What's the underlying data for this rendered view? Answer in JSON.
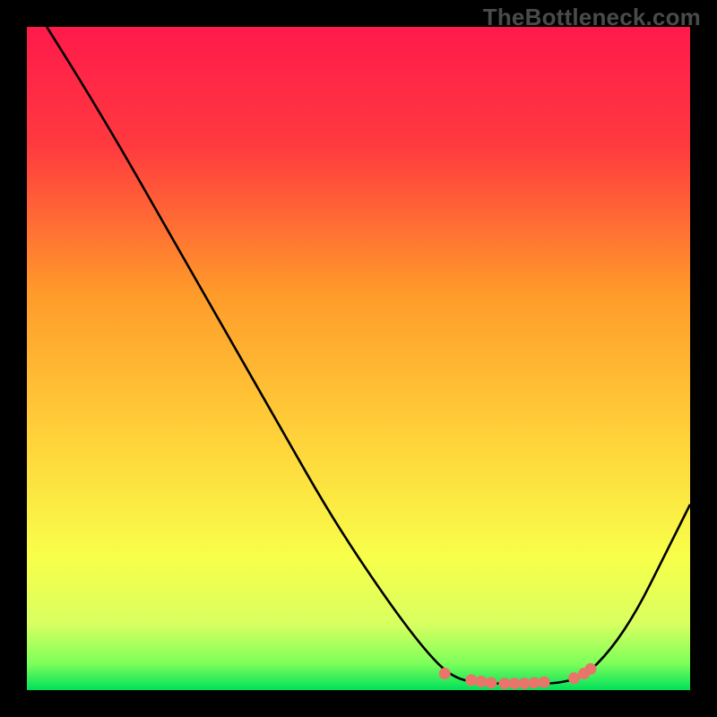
{
  "watermark": "TheBottleneck.com",
  "chart_data": {
    "type": "line",
    "title": "",
    "xlabel": "",
    "ylabel": "",
    "xlim": [
      0,
      100
    ],
    "ylim": [
      0,
      100
    ],
    "gradient_stops": [
      {
        "offset": 0,
        "color": "#ff1a4b"
      },
      {
        "offset": 18,
        "color": "#ff3a3f"
      },
      {
        "offset": 40,
        "color": "#ff9a2a"
      },
      {
        "offset": 62,
        "color": "#ffd23a"
      },
      {
        "offset": 80,
        "color": "#f8ff4a"
      },
      {
        "offset": 90,
        "color": "#d8ff60"
      },
      {
        "offset": 96,
        "color": "#7dff5a"
      },
      {
        "offset": 100,
        "color": "#00e05a"
      }
    ],
    "series": [
      {
        "name": "bottleneck-curve",
        "color": "#000000",
        "points": [
          {
            "x": 3,
            "y": 100
          },
          {
            "x": 8,
            "y": 92
          },
          {
            "x": 14,
            "y": 82
          },
          {
            "x": 22,
            "y": 68
          },
          {
            "x": 30,
            "y": 54
          },
          {
            "x": 38,
            "y": 40
          },
          {
            "x": 46,
            "y": 26
          },
          {
            "x": 54,
            "y": 14
          },
          {
            "x": 60,
            "y": 6
          },
          {
            "x": 64,
            "y": 2
          },
          {
            "x": 68,
            "y": 1
          },
          {
            "x": 72,
            "y": 1
          },
          {
            "x": 76,
            "y": 1
          },
          {
            "x": 80,
            "y": 1
          },
          {
            "x": 84,
            "y": 2
          },
          {
            "x": 88,
            "y": 6
          },
          {
            "x": 92,
            "y": 12
          },
          {
            "x": 96,
            "y": 20
          },
          {
            "x": 100,
            "y": 28
          }
        ]
      }
    ],
    "markers": {
      "name": "highlighted-points",
      "color": "#e9746a",
      "points": [
        {
          "x": 63,
          "y": 2.5
        },
        {
          "x": 67,
          "y": 1.5
        },
        {
          "x": 68.5,
          "y": 1.3
        },
        {
          "x": 70,
          "y": 1.1
        },
        {
          "x": 72,
          "y": 1.0
        },
        {
          "x": 73.5,
          "y": 1.0
        },
        {
          "x": 75,
          "y": 1.0
        },
        {
          "x": 76.5,
          "y": 1.1
        },
        {
          "x": 78,
          "y": 1.2
        },
        {
          "x": 82.5,
          "y": 1.8
        },
        {
          "x": 84,
          "y": 2.5
        },
        {
          "x": 85,
          "y": 3.2
        }
      ]
    }
  }
}
